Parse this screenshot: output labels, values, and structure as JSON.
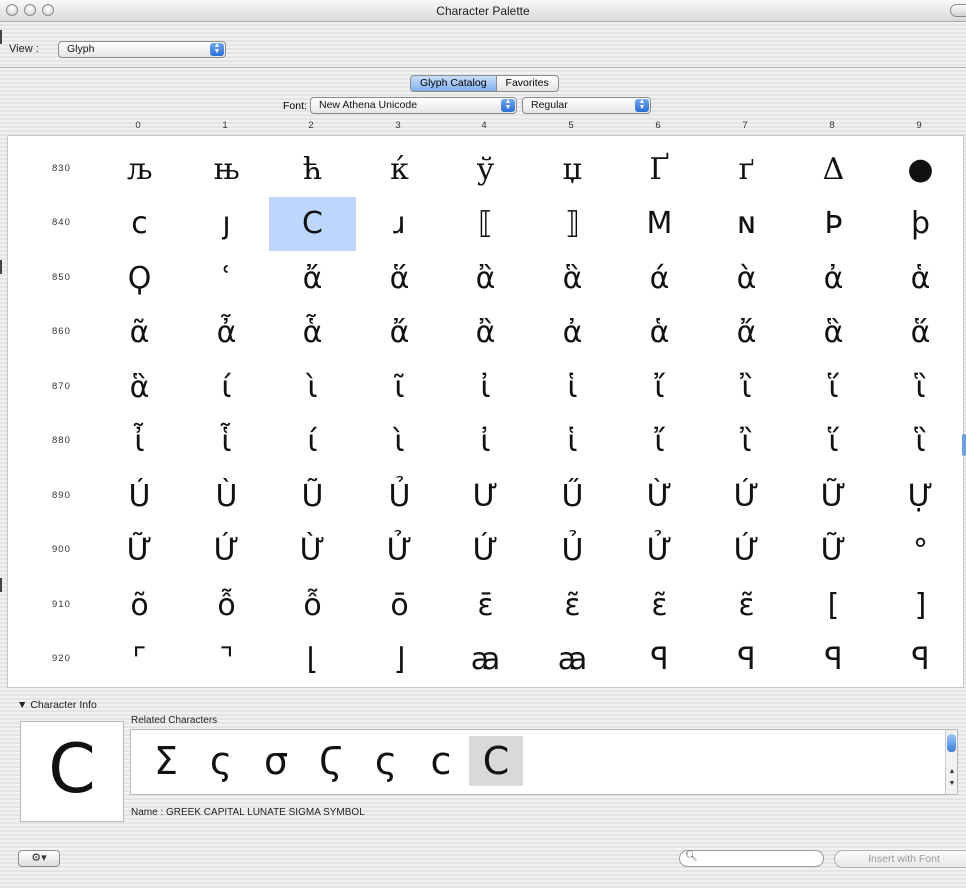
{
  "window": {
    "title": "Character Palette"
  },
  "view": {
    "label": "View :",
    "value": "Glyph"
  },
  "tabs": [
    {
      "label": "Glyph Catalog",
      "selected": true
    },
    {
      "label": "Favorites",
      "selected": false
    }
  ],
  "font": {
    "label": "Font:",
    "family": "New Athena Unicode",
    "style": "Regular"
  },
  "columns": [
    "0",
    "1",
    "2",
    "3",
    "4",
    "5",
    "6",
    "7",
    "8",
    "9"
  ],
  "rows": [
    {
      "label": "830",
      "glyphs": [
        "љ",
        "њ",
        "ћ",
        "ќ",
        "ў",
        "џ",
        "Ґ",
        "ґ",
        "Δ",
        "●"
      ]
    },
    {
      "label": "840",
      "glyphs": [
        "ϲ",
        "ȷ",
        "Ϲ",
        "ɹ",
        "⟦",
        "⟧",
        "Μ",
        "ɴ",
        "Þ",
        "þ"
      ]
    },
    {
      "label": "850",
      "glyphs": [
        "Ϙ",
        "ʿ",
        "ἄ",
        "ἅ",
        "ἂ",
        "ἃ",
        "ά",
        "ὰ",
        "ἀ",
        "ἁ"
      ]
    },
    {
      "label": "860",
      "glyphs": [
        "ᾶ",
        "ἆ",
        "ἇ",
        "ἄ",
        "ἂ",
        "ἀ",
        "ἁ",
        "ἄ",
        "ἃ",
        "ἅ"
      ]
    },
    {
      "label": "870",
      "glyphs": [
        "ἃ",
        "ί",
        "ὶ",
        "ῖ",
        "ἰ",
        "ἱ",
        "ἴ",
        "ἲ",
        "ἵ",
        "ἳ"
      ]
    },
    {
      "label": "880",
      "glyphs": [
        "ἶ",
        "ἷ",
        "ί",
        "ὶ",
        "ἰ",
        "ἱ",
        "ἴ",
        "ἲ",
        "ἵ",
        "ἳ"
      ]
    },
    {
      "label": "890",
      "glyphs": [
        "Ú",
        "Ù",
        "Ũ",
        "Ủ",
        "Ư",
        "Ű",
        "Ừ",
        "Ứ",
        "Ữ",
        "Ự"
      ]
    },
    {
      "label": "900",
      "glyphs": [
        "Ữ",
        "Ứ",
        "Ừ",
        "Ử",
        "Ứ",
        "Ủ",
        "Ử",
        "Ứ",
        "Ữ",
        "°"
      ]
    },
    {
      "label": "910",
      "glyphs": [
        "õ",
        "ỗ",
        "ỗ",
        "ō",
        "ε̄",
        "ε̃",
        "ε̃",
        "ε̃",
        "[",
        "]"
      ]
    },
    {
      "label": "920",
      "glyphs": [
        "⌜",
        "⌝",
        "⌊",
        "⌋",
        "ꜳ",
        "ꜳ",
        "ꟼ",
        "ꟼ",
        "ꟼ",
        "ꟼ"
      ]
    }
  ],
  "selected_cell": {
    "row": 1,
    "col": 2
  },
  "character_info": {
    "header": "Character Info",
    "glyph": "Ϲ",
    "related_label": "Related Characters",
    "related": [
      "Σ",
      "ς",
      "σ",
      "Ϛ",
      "ς",
      "c",
      "Ϲ"
    ],
    "related_selected_index": 6,
    "name_line": "Name :  GREEK CAPITAL LUNATE SIGMA SYMBOL"
  },
  "bottom": {
    "gear": "⚙▾",
    "search_placeholder": "",
    "insert_button": "Insert with Font"
  }
}
